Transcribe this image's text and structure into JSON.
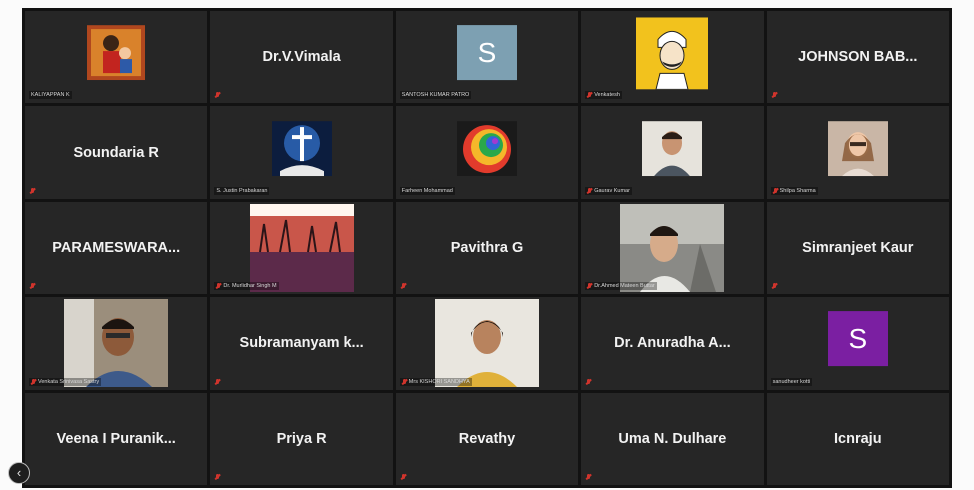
{
  "participants": {
    "t1": {
      "label": "KALIYAPPAN K"
    },
    "t2": {
      "name": "Dr.V.Vimala"
    },
    "t3": {
      "label": "SANTOSH KUMAR PATRO",
      "avatar_letter": "S",
      "avatar_color": "#7da0b2"
    },
    "t4": {
      "label": "Venkatesh"
    },
    "t5": {
      "name": "JOHNSON BAB..."
    },
    "t6": {
      "name": "Soundaria R"
    },
    "t7": {
      "label": "S. Justin Prabakaran"
    },
    "t8": {
      "label": "Farheen Mohammad"
    },
    "t9": {
      "label": "Gaurav Kumar"
    },
    "t10": {
      "label": "Shilpa Sharma"
    },
    "t11": {
      "name": "PARAMESWARA..."
    },
    "t12": {
      "label": "Dr. Murlidhar Singh M"
    },
    "t13": {
      "name": "Pavithra G"
    },
    "t14": {
      "label": "Dr.Ahmed Mateen Buttar"
    },
    "t15": {
      "name": "Simranjeet Kaur"
    },
    "t16": {
      "label": "Venkata Srinivasa Sastry"
    },
    "t17": {
      "name": "Subramanyam k..."
    },
    "t18": {
      "label": "Mrs KISHORI SANDHYA"
    },
    "t19": {
      "name": "Dr. Anuradha A..."
    },
    "t20": {
      "label": "sanudheer kotti",
      "avatar_letter": "S",
      "avatar_color": "#7b1fa2"
    },
    "t21": {
      "name": "Veena I Puranik..."
    },
    "t22": {
      "name": "Priya R"
    },
    "t23": {
      "name": "Revathy"
    },
    "t24": {
      "name": "Uma N. Dulhare"
    },
    "t25": {
      "name": "Icnraju"
    }
  },
  "controls": {
    "back_icon": "‹"
  },
  "colors": {
    "tile_bg": "#262626",
    "grid_bg": "#121212",
    "mic_muted": "#d0342c"
  }
}
